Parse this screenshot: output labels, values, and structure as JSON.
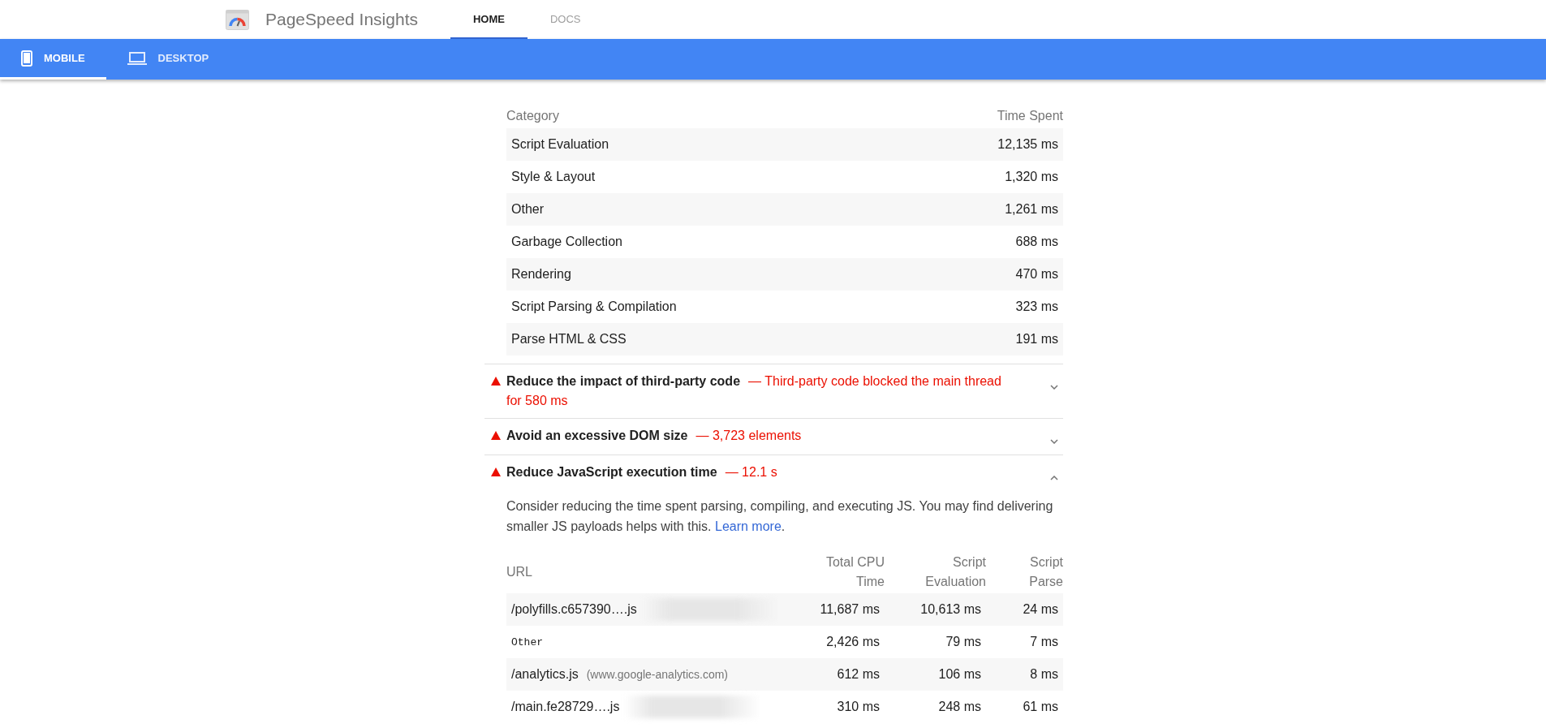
{
  "header": {
    "title": "PageSpeed Insights",
    "nav_tabs": [
      {
        "label": "HOME",
        "selected": true
      },
      {
        "label": "DOCS",
        "selected": false
      }
    ]
  },
  "device_tabs": [
    {
      "label": "MOBILE",
      "kind": "phone",
      "selected": true
    },
    {
      "label": "DESKTOP",
      "kind": "laptop",
      "selected": false
    }
  ],
  "breakdown": {
    "columns": [
      "Category",
      "Time Spent"
    ],
    "rows": [
      {
        "category": "Script Evaluation",
        "time": "12,135 ms"
      },
      {
        "category": "Style & Layout",
        "time": "1,320 ms"
      },
      {
        "category": "Other",
        "time": "1,261 ms"
      },
      {
        "category": "Garbage Collection",
        "time": "688 ms"
      },
      {
        "category": "Rendering",
        "time": "470 ms"
      },
      {
        "category": "Script Parsing & Compilation",
        "time": "323 ms"
      },
      {
        "category": "Parse HTML & CSS",
        "time": "191 ms"
      }
    ]
  },
  "audits": [
    {
      "title": "Reduce the impact of third-party code",
      "value": "— Third-party code blocked the main thread for 580 ms",
      "expanded": false
    },
    {
      "title": "Avoid an excessive DOM size",
      "value": "— 3,723 elements",
      "expanded": false
    },
    {
      "title": "Reduce JavaScript execution time",
      "value": "— 12.1 s",
      "expanded": true,
      "description": "Consider reducing the time spent parsing, compiling, and executing JS. You may find delivering smaller JS payloads helps with this. ",
      "link": "Learn more",
      "description_end": ".",
      "table": {
        "columns": [
          "URL",
          "Total CPU Time",
          "Script Evaluation",
          "Script Parse"
        ],
        "rows": [
          {
            "kind": "script",
            "blurred": true,
            "cells": [
              "/polyfills.c657390….js",
              "11,687 ms",
              "10,613 ms",
              "24 ms"
            ]
          },
          {
            "kind": "other",
            "blurred": false,
            "cells": [
              "Other",
              "2,426 ms",
              "79 ms",
              "7 ms"
            ]
          },
          {
            "kind": "script",
            "blurred": false,
            "host": "(www.google-analytics.com)",
            "cells": [
              "/analytics.js",
              "612 ms",
              "106 ms",
              "8 ms"
            ]
          },
          {
            "kind": "script",
            "blurred": true,
            "cells": [
              "/main.fe28729….js",
              "310 ms",
              "248 ms",
              "61 ms"
            ]
          }
        ]
      }
    }
  ]
}
